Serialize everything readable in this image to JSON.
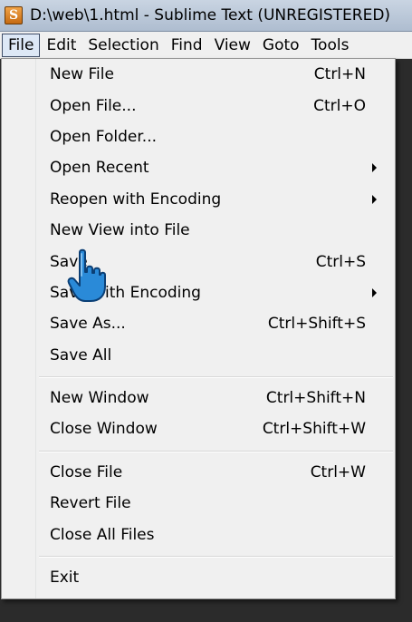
{
  "window": {
    "app_icon_letter": "S",
    "title": "D:\\web\\1.html - Sublime Text (UNREGISTERED)"
  },
  "menubar": {
    "items": [
      {
        "label": "File",
        "active": true
      },
      {
        "label": "Edit"
      },
      {
        "label": "Selection"
      },
      {
        "label": "Find"
      },
      {
        "label": "View"
      },
      {
        "label": "Goto"
      },
      {
        "label": "Tools"
      }
    ]
  },
  "file_menu": {
    "groups": [
      [
        {
          "label": "New File",
          "shortcut": "Ctrl+N"
        },
        {
          "label": "Open File...",
          "shortcut": "Ctrl+O"
        },
        {
          "label": "Open Folder...",
          "shortcut": ""
        },
        {
          "label": "Open Recent",
          "shortcut": "",
          "submenu": true
        },
        {
          "label": "Reopen with Encoding",
          "shortcut": "",
          "submenu": true
        },
        {
          "label": "New View into File",
          "shortcut": ""
        },
        {
          "label": "Save",
          "shortcut": "Ctrl+S"
        },
        {
          "label": "Save with Encoding",
          "shortcut": "",
          "submenu": true
        },
        {
          "label": "Save As...",
          "shortcut": "Ctrl+Shift+S"
        },
        {
          "label": "Save All",
          "shortcut": ""
        }
      ],
      [
        {
          "label": "New Window",
          "shortcut": "Ctrl+Shift+N"
        },
        {
          "label": "Close Window",
          "shortcut": "Ctrl+Shift+W"
        }
      ],
      [
        {
          "label": "Close File",
          "shortcut": "Ctrl+W"
        },
        {
          "label": "Revert File",
          "shortcut": ""
        },
        {
          "label": "Close All Files",
          "shortcut": ""
        }
      ],
      [
        {
          "label": "Exit",
          "shortcut": ""
        }
      ]
    ]
  },
  "cursor": {
    "icon": "hand-pointer-icon",
    "color": "#2a8ad8"
  }
}
